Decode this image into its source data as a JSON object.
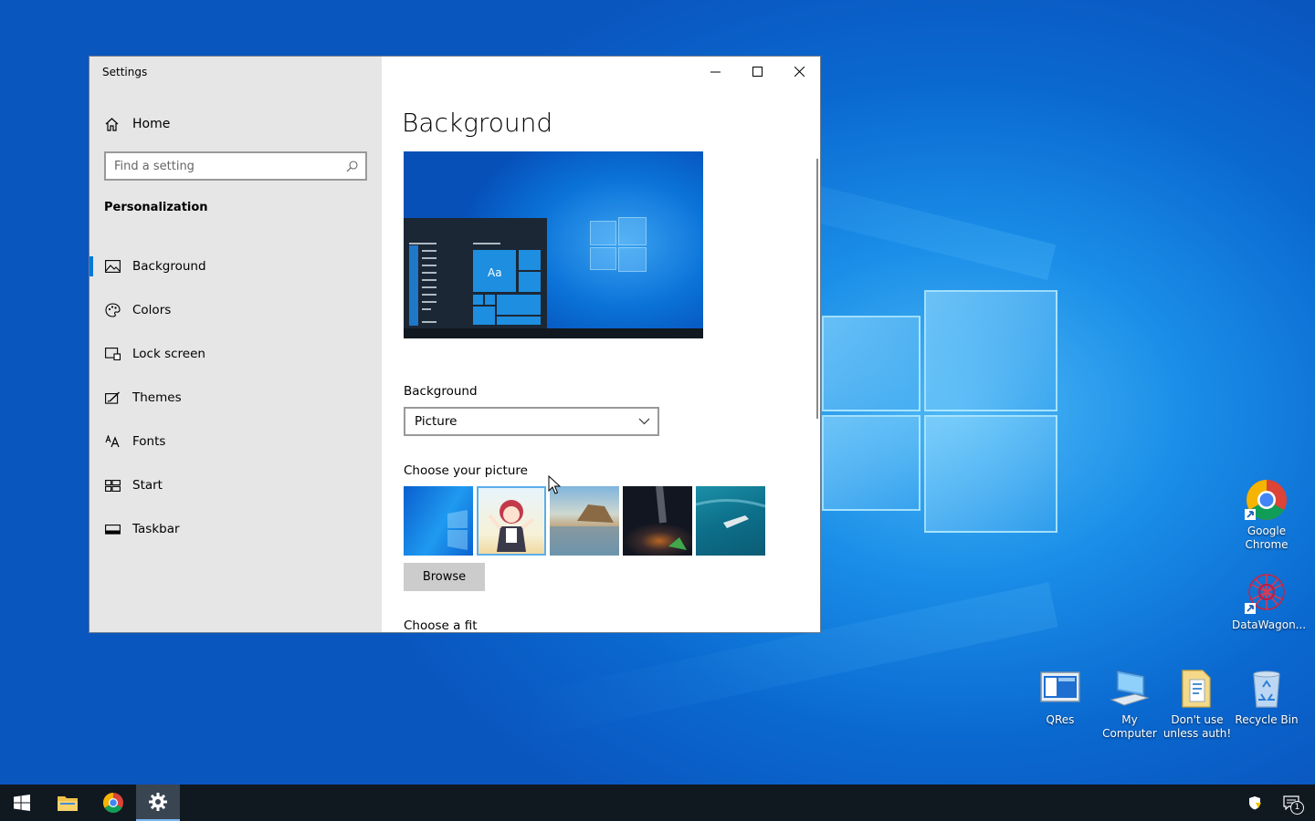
{
  "window": {
    "app_title": "Settings",
    "controls": {
      "minimize": "minimize-icon",
      "maximize": "maximize-icon",
      "close": "close-icon"
    }
  },
  "sidebar": {
    "home_label": "Home",
    "search": {
      "placeholder": "Find a setting"
    },
    "section_label": "Personalization",
    "items": [
      {
        "label": "Background",
        "icon": "picture-icon",
        "active": true
      },
      {
        "label": "Colors",
        "icon": "palette-icon",
        "active": false
      },
      {
        "label": "Lock screen",
        "icon": "lock-screen-icon",
        "active": false
      },
      {
        "label": "Themes",
        "icon": "themes-icon",
        "active": false
      },
      {
        "label": "Fonts",
        "icon": "fonts-icon",
        "active": false
      },
      {
        "label": "Start",
        "icon": "start-icon",
        "active": false
      },
      {
        "label": "Taskbar",
        "icon": "taskbar-icon",
        "active": false
      }
    ]
  },
  "main": {
    "page_title": "Background",
    "preview_tile_text": "Aa",
    "background_label": "Background",
    "background_value": "Picture",
    "choose_picture_label": "Choose your picture",
    "browse_label": "Browse",
    "choose_fit_label": "Choose a fit"
  },
  "desktop_icons": [
    {
      "label": "Google Chrome"
    },
    {
      "label": "DataWagon..."
    },
    {
      "label": "QRes"
    },
    {
      "label": "My Computer"
    },
    {
      "label": "Don't use unless auth!"
    },
    {
      "label": "Recycle Bin"
    }
  ],
  "taskbar": {
    "notification_count": "1"
  },
  "colors": {
    "accent": "#0078d7",
    "sidebar_bg": "#e6e6e6",
    "taskbar_bg": "#101820"
  }
}
